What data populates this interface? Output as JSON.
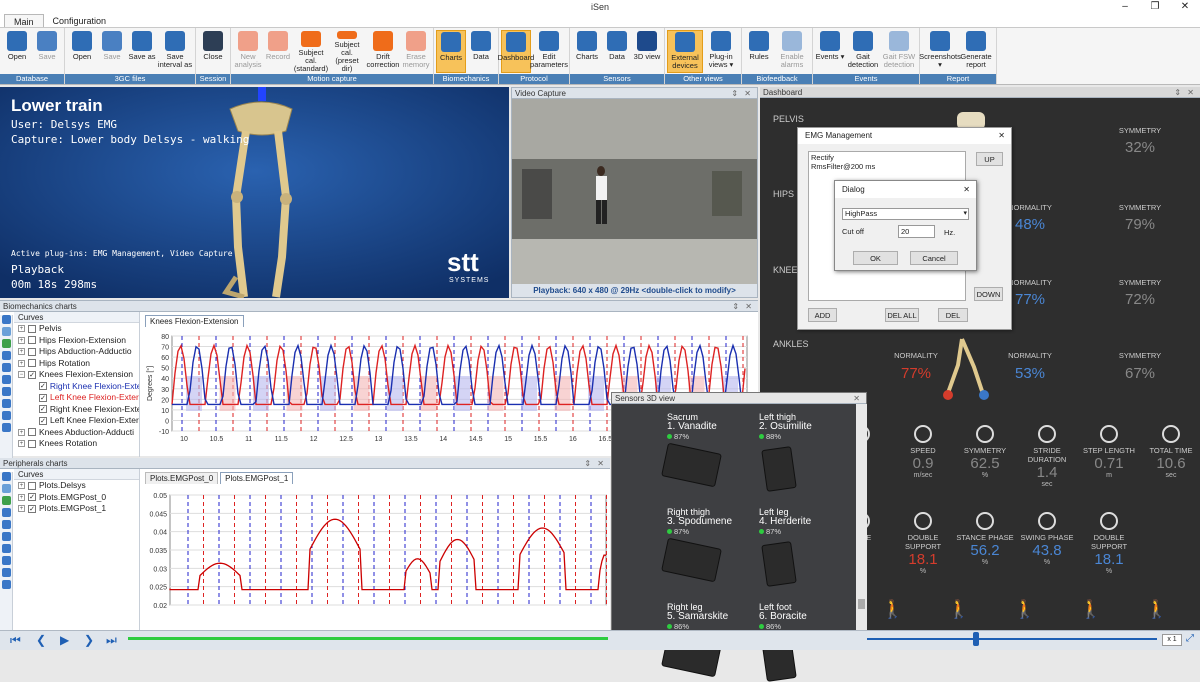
{
  "window": {
    "title": "iSen",
    "controls": [
      "–",
      "❐",
      "✕"
    ]
  },
  "tabs": [
    {
      "label": "Main",
      "active": true
    },
    {
      "label": "Configuration",
      "active": false
    }
  ],
  "ribbon": {
    "groups": [
      {
        "label": "Database",
        "buttons": [
          {
            "label": "Open",
            "icon": "folder-icon"
          },
          {
            "label": "Save",
            "icon": "save-icon",
            "disabled": true
          }
        ]
      },
      {
        "label": "3GC files",
        "buttons": [
          {
            "label": "Open",
            "icon": "folder-icon"
          },
          {
            "label": "Save",
            "icon": "save-icon",
            "disabled": true
          },
          {
            "label": "Save as",
            "icon": "save-as-icon"
          },
          {
            "label": "Save interval as",
            "icon": "save-interval-icon"
          }
        ]
      },
      {
        "label": "Session",
        "buttons": [
          {
            "label": "Close",
            "icon": "close-icon"
          }
        ]
      },
      {
        "label": "Motion capture",
        "buttons": [
          {
            "label": "New analysis",
            "icon": "new-analysis-icon",
            "disabled": true
          },
          {
            "label": "Record",
            "icon": "record-icon",
            "disabled": true
          },
          {
            "label": "Subject cal. (standard)",
            "icon": "subject-cal-icon"
          },
          {
            "label": "Subject cal. (preset dir)",
            "icon": "subject-cal-preset-icon"
          },
          {
            "label": "Drift correction",
            "icon": "drift-icon"
          },
          {
            "label": "Erase memory",
            "icon": "erase-icon",
            "disabled": true
          }
        ]
      },
      {
        "label": "Biomechanics",
        "buttons": [
          {
            "label": "Charts",
            "icon": "charts-icon",
            "highlighted": true
          },
          {
            "label": "Data",
            "icon": "data-icon"
          }
        ]
      },
      {
        "label": "Protocol",
        "buttons": [
          {
            "label": "Dashboard",
            "icon": "dashboard-icon",
            "highlighted": true
          },
          {
            "label": "Edit parameters",
            "icon": "edit-parameters-icon"
          }
        ]
      },
      {
        "label": "Sensors",
        "buttons": [
          {
            "label": "Charts",
            "icon": "charts-icon"
          },
          {
            "label": "Data",
            "icon": "data-icon"
          },
          {
            "label": "3D view",
            "icon": "3d-view-icon"
          }
        ]
      },
      {
        "label": "Other views",
        "buttons": [
          {
            "label": "External devices",
            "icon": "external-devices-icon",
            "highlighted": true
          },
          {
            "label": "Plug-in views ▾",
            "icon": "plugin-icon"
          }
        ]
      },
      {
        "label": "Biofeedback",
        "buttons": [
          {
            "label": "Rules",
            "icon": "rules-icon"
          },
          {
            "label": "Enable alarms",
            "icon": "alarm-icon",
            "disabled": true
          }
        ]
      },
      {
        "label": "Events",
        "buttons": [
          {
            "label": "Events ▾",
            "icon": "flag-icon"
          },
          {
            "label": "Gait detection",
            "icon": "gait-detection-icon"
          },
          {
            "label": "Gait FSW detection",
            "icon": "gait-fsw-icon",
            "disabled": true
          }
        ]
      },
      {
        "label": "Report",
        "buttons": [
          {
            "label": "Screenshots ▾",
            "icon": "screenshot-icon"
          },
          {
            "label": "Generate report",
            "icon": "report-icon"
          }
        ]
      }
    ]
  },
  "viewport": {
    "title": "Lower train",
    "user_line": "User: Delsys EMG",
    "capture_line": "Capture: Lower body Delsys  - walking",
    "plugins_line": "Active plug-ins: EMG Management, Video Capture",
    "mode": "Playback",
    "time": "00m 18s 298ms",
    "logo_text": "stt",
    "logo_sub": "SYSTEMS"
  },
  "video": {
    "header": "Video Capture",
    "status": "Playback: 640 x 480 @ 29Hz <double-click to modify>"
  },
  "bio_charts": {
    "header": "Biomechanics charts",
    "curves_label": "Curves",
    "tree": [
      {
        "label": "Pelvis",
        "level": 0,
        "checked": false,
        "expander": "+"
      },
      {
        "label": "Hips Flexion-Extension",
        "level": 0,
        "checked": false,
        "expander": "+"
      },
      {
        "label": "Hips Abduction-Adductio",
        "level": 0,
        "checked": false,
        "expander": "+"
      },
      {
        "label": "Hips Rotation",
        "level": 0,
        "checked": false,
        "expander": "+"
      },
      {
        "label": "Knees Flexion-Extension",
        "level": 0,
        "checked": true,
        "expander": "−"
      },
      {
        "label": "Right Knee Flexion-Exte",
        "level": 1,
        "checked": true,
        "color": "#1a2fb0"
      },
      {
        "label": "Left Knee Flexion-Exter",
        "level": 1,
        "checked": true,
        "color": "#d22"
      },
      {
        "label": "Right Knee Flexion-Exte",
        "level": 1,
        "checked": true
      },
      {
        "label": "Left Knee Flexion-Exter",
        "level": 1,
        "checked": true
      },
      {
        "label": "Knees Abduction-Adducti",
        "level": 0,
        "checked": false,
        "expander": "+"
      },
      {
        "label": "Knees Rotation",
        "level": 0,
        "checked": false,
        "expander": "+"
      }
    ],
    "chart_tab": "Knees Flexion-Extension",
    "ylabel": "Degrees [°]",
    "yticks": [
      "80",
      "70",
      "60",
      "50",
      "40",
      "30",
      "20",
      "10",
      "0",
      "-10"
    ],
    "xticks": [
      "10",
      "10.5",
      "11",
      "11.5",
      "12",
      "12.5",
      "13",
      "13.5",
      "14",
      "14.5",
      "15",
      "15.5",
      "16",
      "16.5",
      "17",
      "17.5",
      "18",
      "18.5"
    ]
  },
  "periph_charts": {
    "header": "Peripherals charts",
    "curves_label": "Curves",
    "tree": [
      {
        "label": "Plots.Delsys",
        "checked": false
      },
      {
        "label": "Plots.EMGPost_0",
        "checked": true
      },
      {
        "label": "Plots.EMGPost_1",
        "checked": true
      }
    ],
    "tabs": [
      {
        "label": "Plots.EMGPost_0",
        "active": false
      },
      {
        "label": "Plots.EMGPost_1",
        "active": true
      }
    ],
    "yticks": [
      "0.05",
      "0.045",
      "0.04",
      "0.035",
      "0.03",
      "0.025",
      "0.02"
    ]
  },
  "dashboard": {
    "header": "Dashboard",
    "sections": [
      {
        "label": "PELVIS",
        "symmetry_label": "SYMMETRY",
        "symmetry": "32%"
      },
      {
        "label": "HIPS",
        "normality_label": "NORMALITY",
        "normality": "48%",
        "symmetry_label": "SYMMETRY",
        "symmetry": "79%"
      },
      {
        "label": "KNEES",
        "normality_label": "NORMALITY",
        "normality": "77%",
        "symmetry_label": "SYMMETRY",
        "symmetry": "72%"
      },
      {
        "label": "ANKLES",
        "left_normality_label": "NORMALITY",
        "left_normality": "77%",
        "normality_label": "NORMALITY",
        "normality": "53%",
        "symmetry_label": "SYMMETRY",
        "symmetry": "67%"
      }
    ],
    "metrics": [
      {
        "label": "CE",
        "value": "3",
        "unit": "min"
      },
      {
        "label": "SPEED",
        "value": "0.9",
        "unit": "m/sec"
      },
      {
        "label": "SYMMETRY",
        "value": "62.5",
        "unit": "%"
      },
      {
        "label": "STRIDE DURATION",
        "value": "1.4",
        "unit": "sec"
      },
      {
        "label": "STEP LENGTH",
        "value": "0.71",
        "unit": "m"
      },
      {
        "label": "TOTAL TIME",
        "value": "10.6",
        "unit": "sec"
      }
    ],
    "phases": [
      {
        "label": "HASE",
        "value": "1",
        "unit": ""
      },
      {
        "label": "DOUBLE SUPPORT",
        "value": "18.1",
        "unit": "%"
      },
      {
        "label": "STANCE PHASE",
        "value": "56.2",
        "unit": "%"
      },
      {
        "label": "SWING PHASE",
        "value": "43.8",
        "unit": "%"
      },
      {
        "label": "DOUBLE SUPPORT",
        "value": "18.1",
        "unit": "%"
      }
    ]
  },
  "emg_dialog": {
    "title": "EMG Management",
    "close": "✕",
    "list": [
      "Rectify",
      "RmsFilter@200 ms"
    ],
    "up": "UP",
    "down": "DOWN",
    "add": "ADD",
    "del_all": "DEL ALL",
    "del": "DEL"
  },
  "sub_dialog": {
    "title": "Dialog",
    "close": "✕",
    "filter": "HighPass",
    "cutoff_label": "Cut off",
    "cutoff_value": "20",
    "unit": "Hz.",
    "ok": "OK",
    "cancel": "Cancel"
  },
  "sensors3d": {
    "header": "Sensors 3D view",
    "sensors": [
      {
        "location": "Sacrum",
        "name": "1. Vanadite",
        "battery": "87%"
      },
      {
        "location": "Left thigh",
        "name": "2. Osumilite",
        "battery": "88%"
      },
      {
        "location": "Right thigh",
        "name": "3. Spodumene",
        "battery": "87%"
      },
      {
        "location": "Left leg",
        "name": "4. Herderite",
        "battery": "87%"
      },
      {
        "location": "Right leg",
        "name": "5. Samarskite",
        "battery": "86%"
      },
      {
        "location": "Left foot",
        "name": "6. Boracite",
        "battery": "86%"
      }
    ]
  },
  "playbar": {
    "speed": "x 1"
  }
}
